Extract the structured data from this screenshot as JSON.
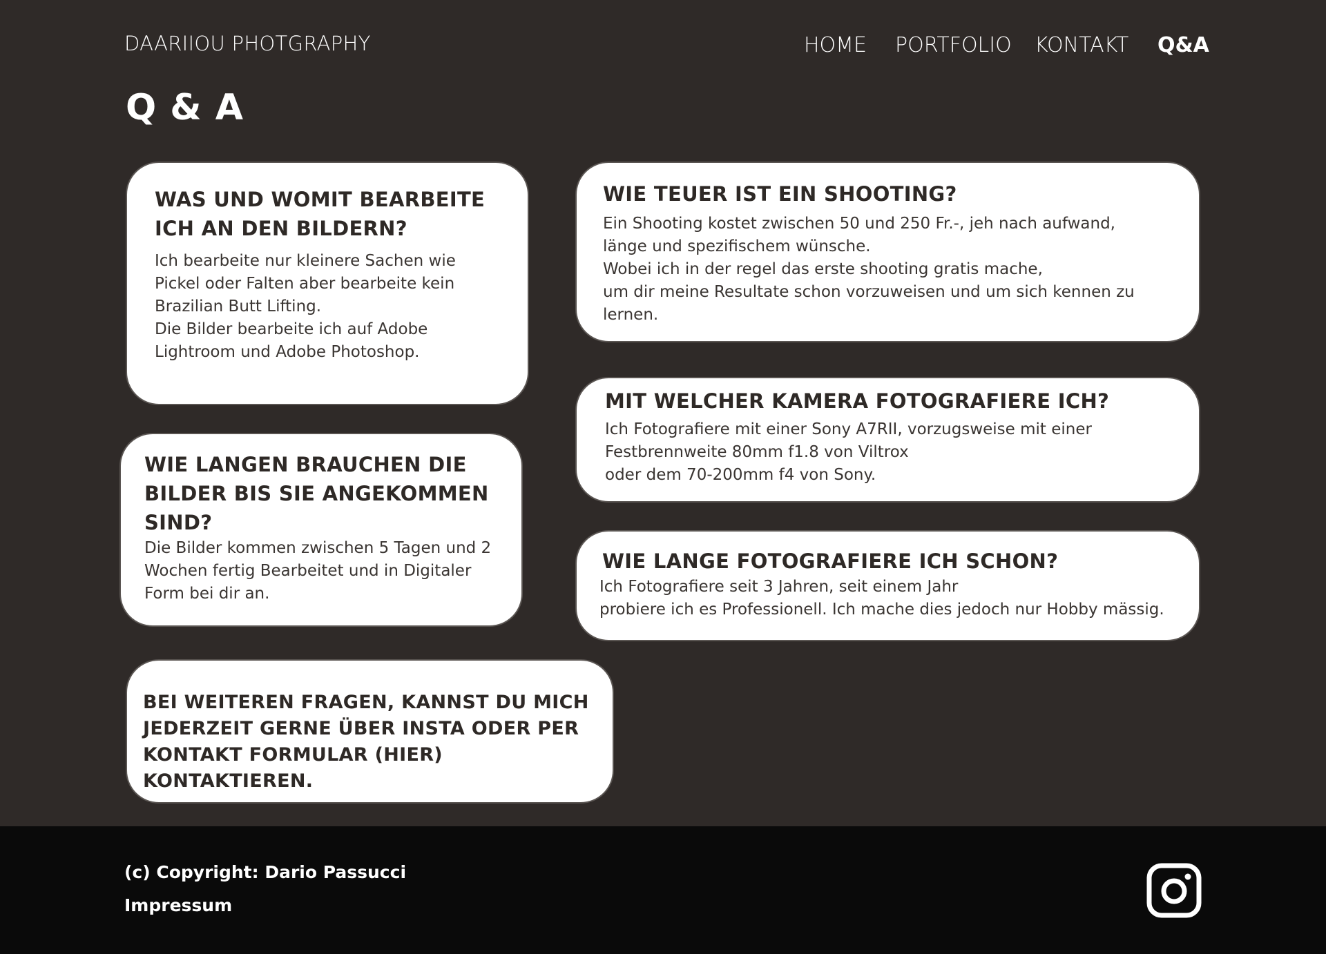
{
  "header": {
    "brand": "DAARIIOU PHOTGRAPHY",
    "nav": [
      {
        "label": "HOME",
        "active": false
      },
      {
        "label": "PORTFOLIO",
        "active": false
      },
      {
        "label": "KONTAKT",
        "active": false
      },
      {
        "label": "Q&A",
        "active": true
      }
    ]
  },
  "page": {
    "title": "Q & A"
  },
  "qa": [
    {
      "question": "WAS UND WOMIT BEARBEITE ICH AN DEN BILDERN?",
      "answer": "Ich bearbeite nur kleinere Sachen wie Pickel oder Falten aber bearbeite kein Brazilian Butt Lifting.\nDie Bilder bearbeite ich auf Adobe Lightroom und Adobe Photoshop."
    },
    {
      "question": "WIE TEUER IST EIN SHOOTING?",
      "answer": "Ein Shooting kostet zwischen 50 und 250 Fr.-, jeh nach aufwand,\nlänge und spezifischem wünsche.\nWobei ich in der regel das erste shooting gratis mache,\num dir meine Resultate schon vorzuweisen und um sich kennen zu lernen."
    },
    {
      "question": "MIT WELCHER KAMERA FOTOGRAFIERE ICH?",
      "answer": "Ich Fotografiere mit einer Sony A7RII, vorzugsweise mit einer\nFestbrennweite 80mm f1.8 von Viltrox\noder dem 70-200mm f4 von Sony."
    },
    {
      "question": "WIE LANGEN BRAUCHEN DIE BILDER BIS SIE ANGEKOMMEN SIND?",
      "answer": "Die Bilder kommen zwischen 5 Tagen und 2 Wochen fertig Bearbeitet und in Digitaler Form bei dir an."
    },
    {
      "question": "WIE LANGE FOTOGRAFIERE ICH SCHON?",
      "answer": "Ich Fotografiere seit 3 Jahren, seit einem Jahr\nprobiere ich es Professionell. Ich mache dies jedoch nur Hobby mässig."
    }
  ],
  "contact_note": "BEI WEITEREN FRAGEN, KANNST DU MICH JEDERZEIT GERNE ÜBER INSTA ODER PER KONTAKT FORMULAR (HIER) KONTAKTIEREN.",
  "footer": {
    "copyright": "(c) Copyright: Dario Passucci",
    "impressum": "Impressum",
    "social_icon": "instagram-icon"
  },
  "colors": {
    "background": "#2f2a28",
    "card": "#ffffff",
    "card_text": "#2e2926",
    "footer": "#0a0a0a"
  }
}
